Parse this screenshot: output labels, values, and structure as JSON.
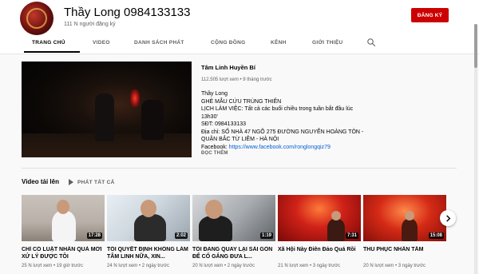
{
  "channel": {
    "name": "Thầy Long 0984133133",
    "subscribers": "111 N người đăng ký",
    "subscribe_label": "ĐĂNG KÝ",
    "accent_color": "#cc0000"
  },
  "tabs": [
    {
      "label": "TRANG CHỦ",
      "active": true
    },
    {
      "label": "VIDEO",
      "active": false
    },
    {
      "label": "DANH SÁCH PHÁT",
      "active": false
    },
    {
      "label": "CỘNG ĐỒNG",
      "active": false
    },
    {
      "label": "KÊNH",
      "active": false
    },
    {
      "label": "GIỚI THIỆU",
      "active": false
    }
  ],
  "featured": {
    "title": "Tâm Linh Huyền Bí",
    "meta": "112.505 lượt xem • 9 tháng trước",
    "description_lines": [
      "Thầy Long",
      "GHẺ MẪU CỨU TRÙNG THIÊN",
      "LỊCH LÀM VIỆC: Tất cả các buổi chiều trong tuần bắt đầu lúc 13h30'",
      "SĐT: 0984133133",
      "Địa chỉ: SỐ NHÀ 47 NGÕ 275 ĐƯỜNG NGUYỄN HOÀNG TÔN - QUẬN BẮC TỪ LIÊM - HÀ NỘI"
    ],
    "facebook_prefix": "Facebook: ",
    "facebook_link": "https://www.facebook.com/ronglongqiz79",
    "read_more": "ĐỌC THÊM"
  },
  "shelf": {
    "title": "Video tải lên",
    "play_all": "PHÁT TẤT CẢ",
    "videos": [
      {
        "title": "CHỈ CÓ LUẬT NHÂN QUẢ MỚI XỬ LÝ ĐƯỢC TÔI",
        "duration": "17:28",
        "meta": "25 N lượt xem • 19 giờ trước"
      },
      {
        "title": "TÔI QUYẾT ĐỊNH KHÔNG LÀM TÂM LINH NỮA, XIN...",
        "duration": "2:02",
        "meta": "24 N lượt xem • 2 ngày trước"
      },
      {
        "title": "TÔI ĐANG QUAY LẠI SÀI GÒN ĐỂ CỐ GẮNG ĐƯA L...",
        "duration": "1:19",
        "meta": "20 N lượt xem • 2 ngày trước"
      },
      {
        "title": "Xã Hội Này Điên Đảo Quá Rồi",
        "duration": "7:31",
        "meta": "21 N lượt xem • 3 ngày trước"
      },
      {
        "title": "THU PHỤC NHÂN TÂM",
        "duration": "15:08",
        "meta": "20 N lượt xem • 3 ngày trước"
      }
    ]
  }
}
